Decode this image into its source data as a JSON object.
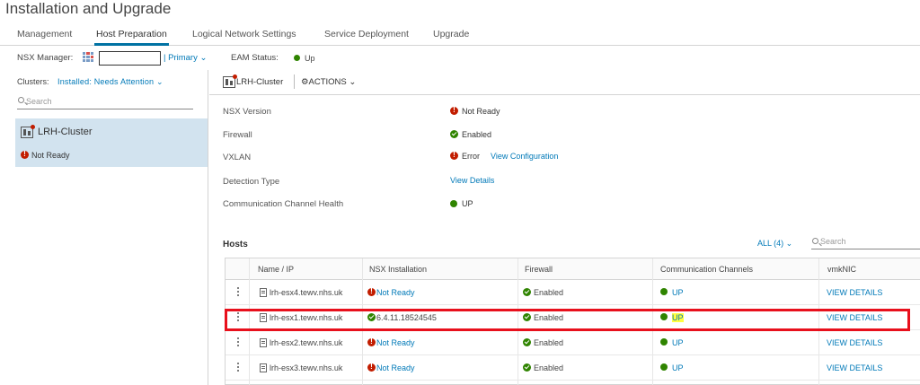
{
  "page": {
    "title": "Installation and Upgrade"
  },
  "tabs": [
    {
      "label": "Management"
    },
    {
      "label": "Host Preparation"
    },
    {
      "label": "Logical Network Settings"
    },
    {
      "label": "Service Deployment"
    },
    {
      "label": "Upgrade"
    }
  ],
  "manager_bar": {
    "nsx_manager_label": "NSX Manager:",
    "primary_label": "| Primary ⌄",
    "eam_status_label": "EAM Status:",
    "eam_status_value": "Up"
  },
  "left": {
    "clusters_label": "Clusters:",
    "clusters_filter": "Installed: Needs Attention ⌄",
    "search_placeholder": "Search",
    "cluster": {
      "name": "LRH-Cluster",
      "status": "Not Ready"
    }
  },
  "context": {
    "name": "LRH-Cluster",
    "actions_label": "⚙ACTIONS ⌄"
  },
  "properties": [
    {
      "label": "NSX Version",
      "value": "Not Ready",
      "status": "error"
    },
    {
      "label": "Firewall",
      "value": "Enabled",
      "status": "ok"
    },
    {
      "label": "VXLAN",
      "value": "Error",
      "status": "error",
      "link": "View Configuration"
    },
    {
      "label": "Detection Type",
      "link": "View Details"
    },
    {
      "label": "Communication Channel Health",
      "value": "UP",
      "status": "up"
    }
  ],
  "hosts": {
    "title": "Hosts",
    "filter": "ALL (4) ⌄",
    "search_placeholder": "Search",
    "columns": [
      "Name / IP",
      "NSX Installation",
      "Firewall",
      "Communication Channels",
      "vmkNIC"
    ],
    "rows": [
      {
        "name": "lrh-esx4.tewv.nhs.uk",
        "nsx": "Not Ready",
        "nsx_status": "error",
        "firewall": "Enabled",
        "comm": "UP",
        "vmknic": "VIEW DETAILS"
      },
      {
        "name": "lrh-esx1.tewv.nhs.uk",
        "nsx": "6.4.11.18524545",
        "nsx_status": "ok",
        "firewall": "Enabled",
        "comm": "UP",
        "vmknic": "VIEW DETAILS"
      },
      {
        "name": "lrh-esx2.tewv.nhs.uk",
        "nsx": "Not Ready",
        "nsx_status": "error",
        "firewall": "Enabled",
        "comm": "UP",
        "vmknic": "VIEW DETAILS"
      },
      {
        "name": "lrh-esx3.tewv.nhs.uk",
        "nsx": "Not Ready",
        "nsx_status": "error",
        "firewall": "Enabled",
        "comm": "UP",
        "vmknic": "VIEW DETAILS"
      }
    ]
  },
  "colors": {
    "accent": "#0079b8",
    "ok": "#2f8400",
    "error": "#c21d00",
    "highlight_box": "#e8101c",
    "highlight_text": "#ffff40"
  }
}
